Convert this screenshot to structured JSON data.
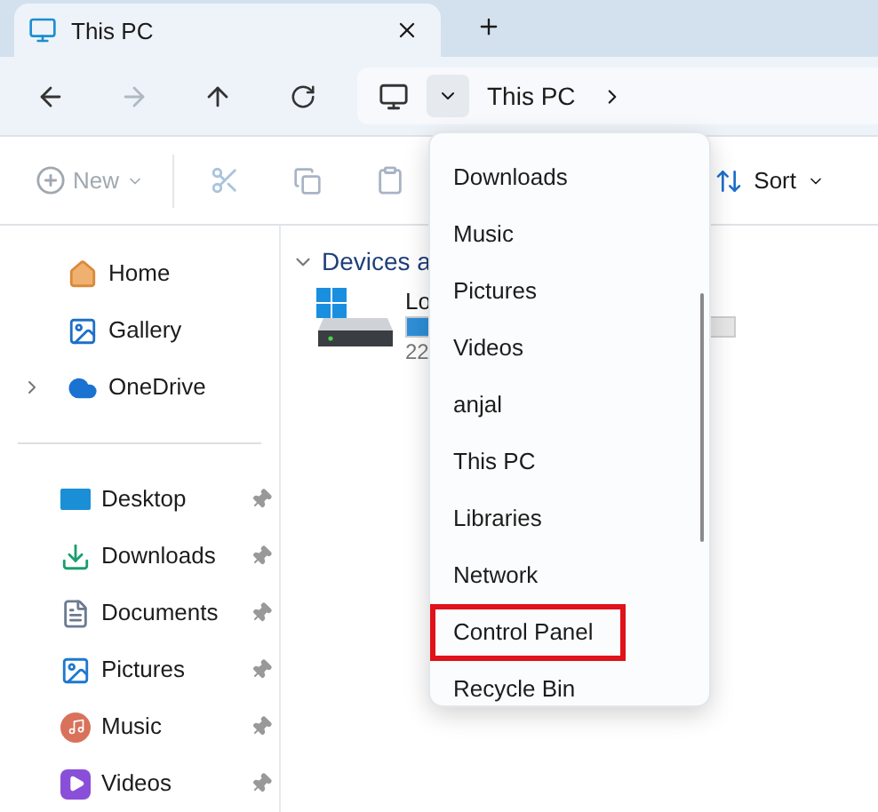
{
  "tabs": [
    {
      "title": "This PC",
      "selected": true
    }
  ],
  "nav": {
    "back_disabled": false,
    "forward_disabled": true
  },
  "address": {
    "crumbs": [
      "This PC"
    ]
  },
  "toolbar": {
    "new": {
      "label": "New",
      "disabled": true
    },
    "sort": {
      "label": "Sort"
    }
  },
  "sidebar": {
    "top": [
      {
        "label": "Home",
        "expandable": false
      },
      {
        "label": "Gallery",
        "expandable": false
      },
      {
        "label": "OneDrive",
        "expandable": true
      }
    ],
    "pinned": [
      {
        "label": "Desktop",
        "pinned": true
      },
      {
        "label": "Downloads",
        "pinned": true
      },
      {
        "label": "Documents",
        "pinned": true
      },
      {
        "label": "Pictures",
        "pinned": true
      },
      {
        "label": "Music",
        "pinned": true
      },
      {
        "label": "Videos",
        "pinned": true
      }
    ]
  },
  "content": {
    "group": "Devices a",
    "drive": {
      "name": "Lo",
      "detail": "22"
    }
  },
  "dropdown": {
    "items": [
      {
        "label": "Downloads",
        "highlighted": false
      },
      {
        "label": "Music",
        "highlighted": false
      },
      {
        "label": "Pictures",
        "highlighted": false
      },
      {
        "label": "Videos",
        "highlighted": false
      },
      {
        "label": "anjal",
        "highlighted": false
      },
      {
        "label": "This PC",
        "highlighted": false
      },
      {
        "label": "Libraries",
        "highlighted": false
      },
      {
        "label": "Network",
        "highlighted": false
      },
      {
        "label": "Control Panel",
        "highlighted": true
      },
      {
        "label": "Recycle Bin",
        "highlighted": false
      }
    ]
  }
}
